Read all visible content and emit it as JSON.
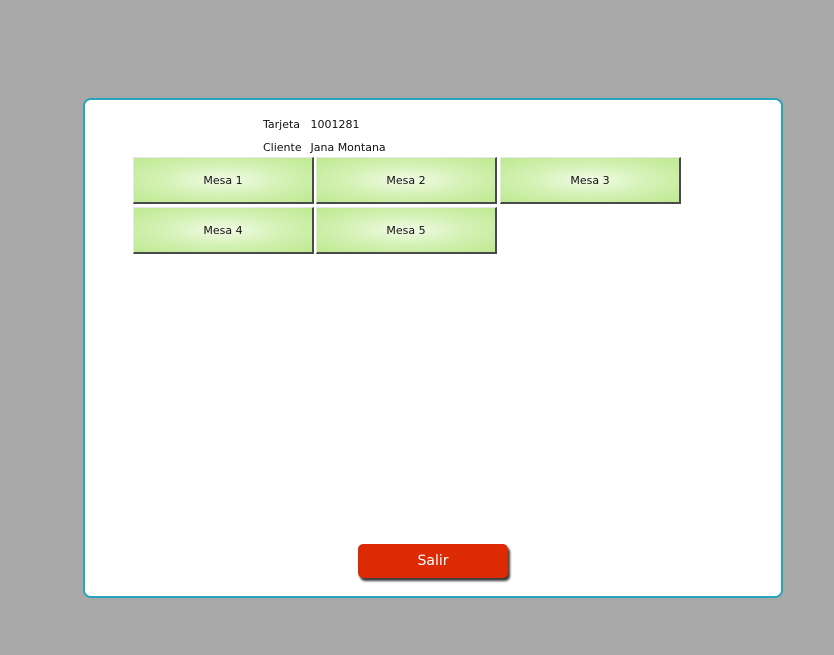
{
  "client_info": {
    "card_label": "Tarjeta",
    "card_value": "1001281",
    "client_label": "Cliente",
    "client_value": "Jana Montana"
  },
  "tables": [
    "Mesa 1",
    "Mesa 2",
    "Mesa 3",
    "Mesa 4",
    "Mesa 5"
  ],
  "actions": {
    "exit_label": "Salir"
  },
  "colors": {
    "background": "#a8a8a8",
    "panel_border": "#2aa3bd",
    "table_button": "#c9ef9f",
    "exit_button": "#db2a04"
  }
}
